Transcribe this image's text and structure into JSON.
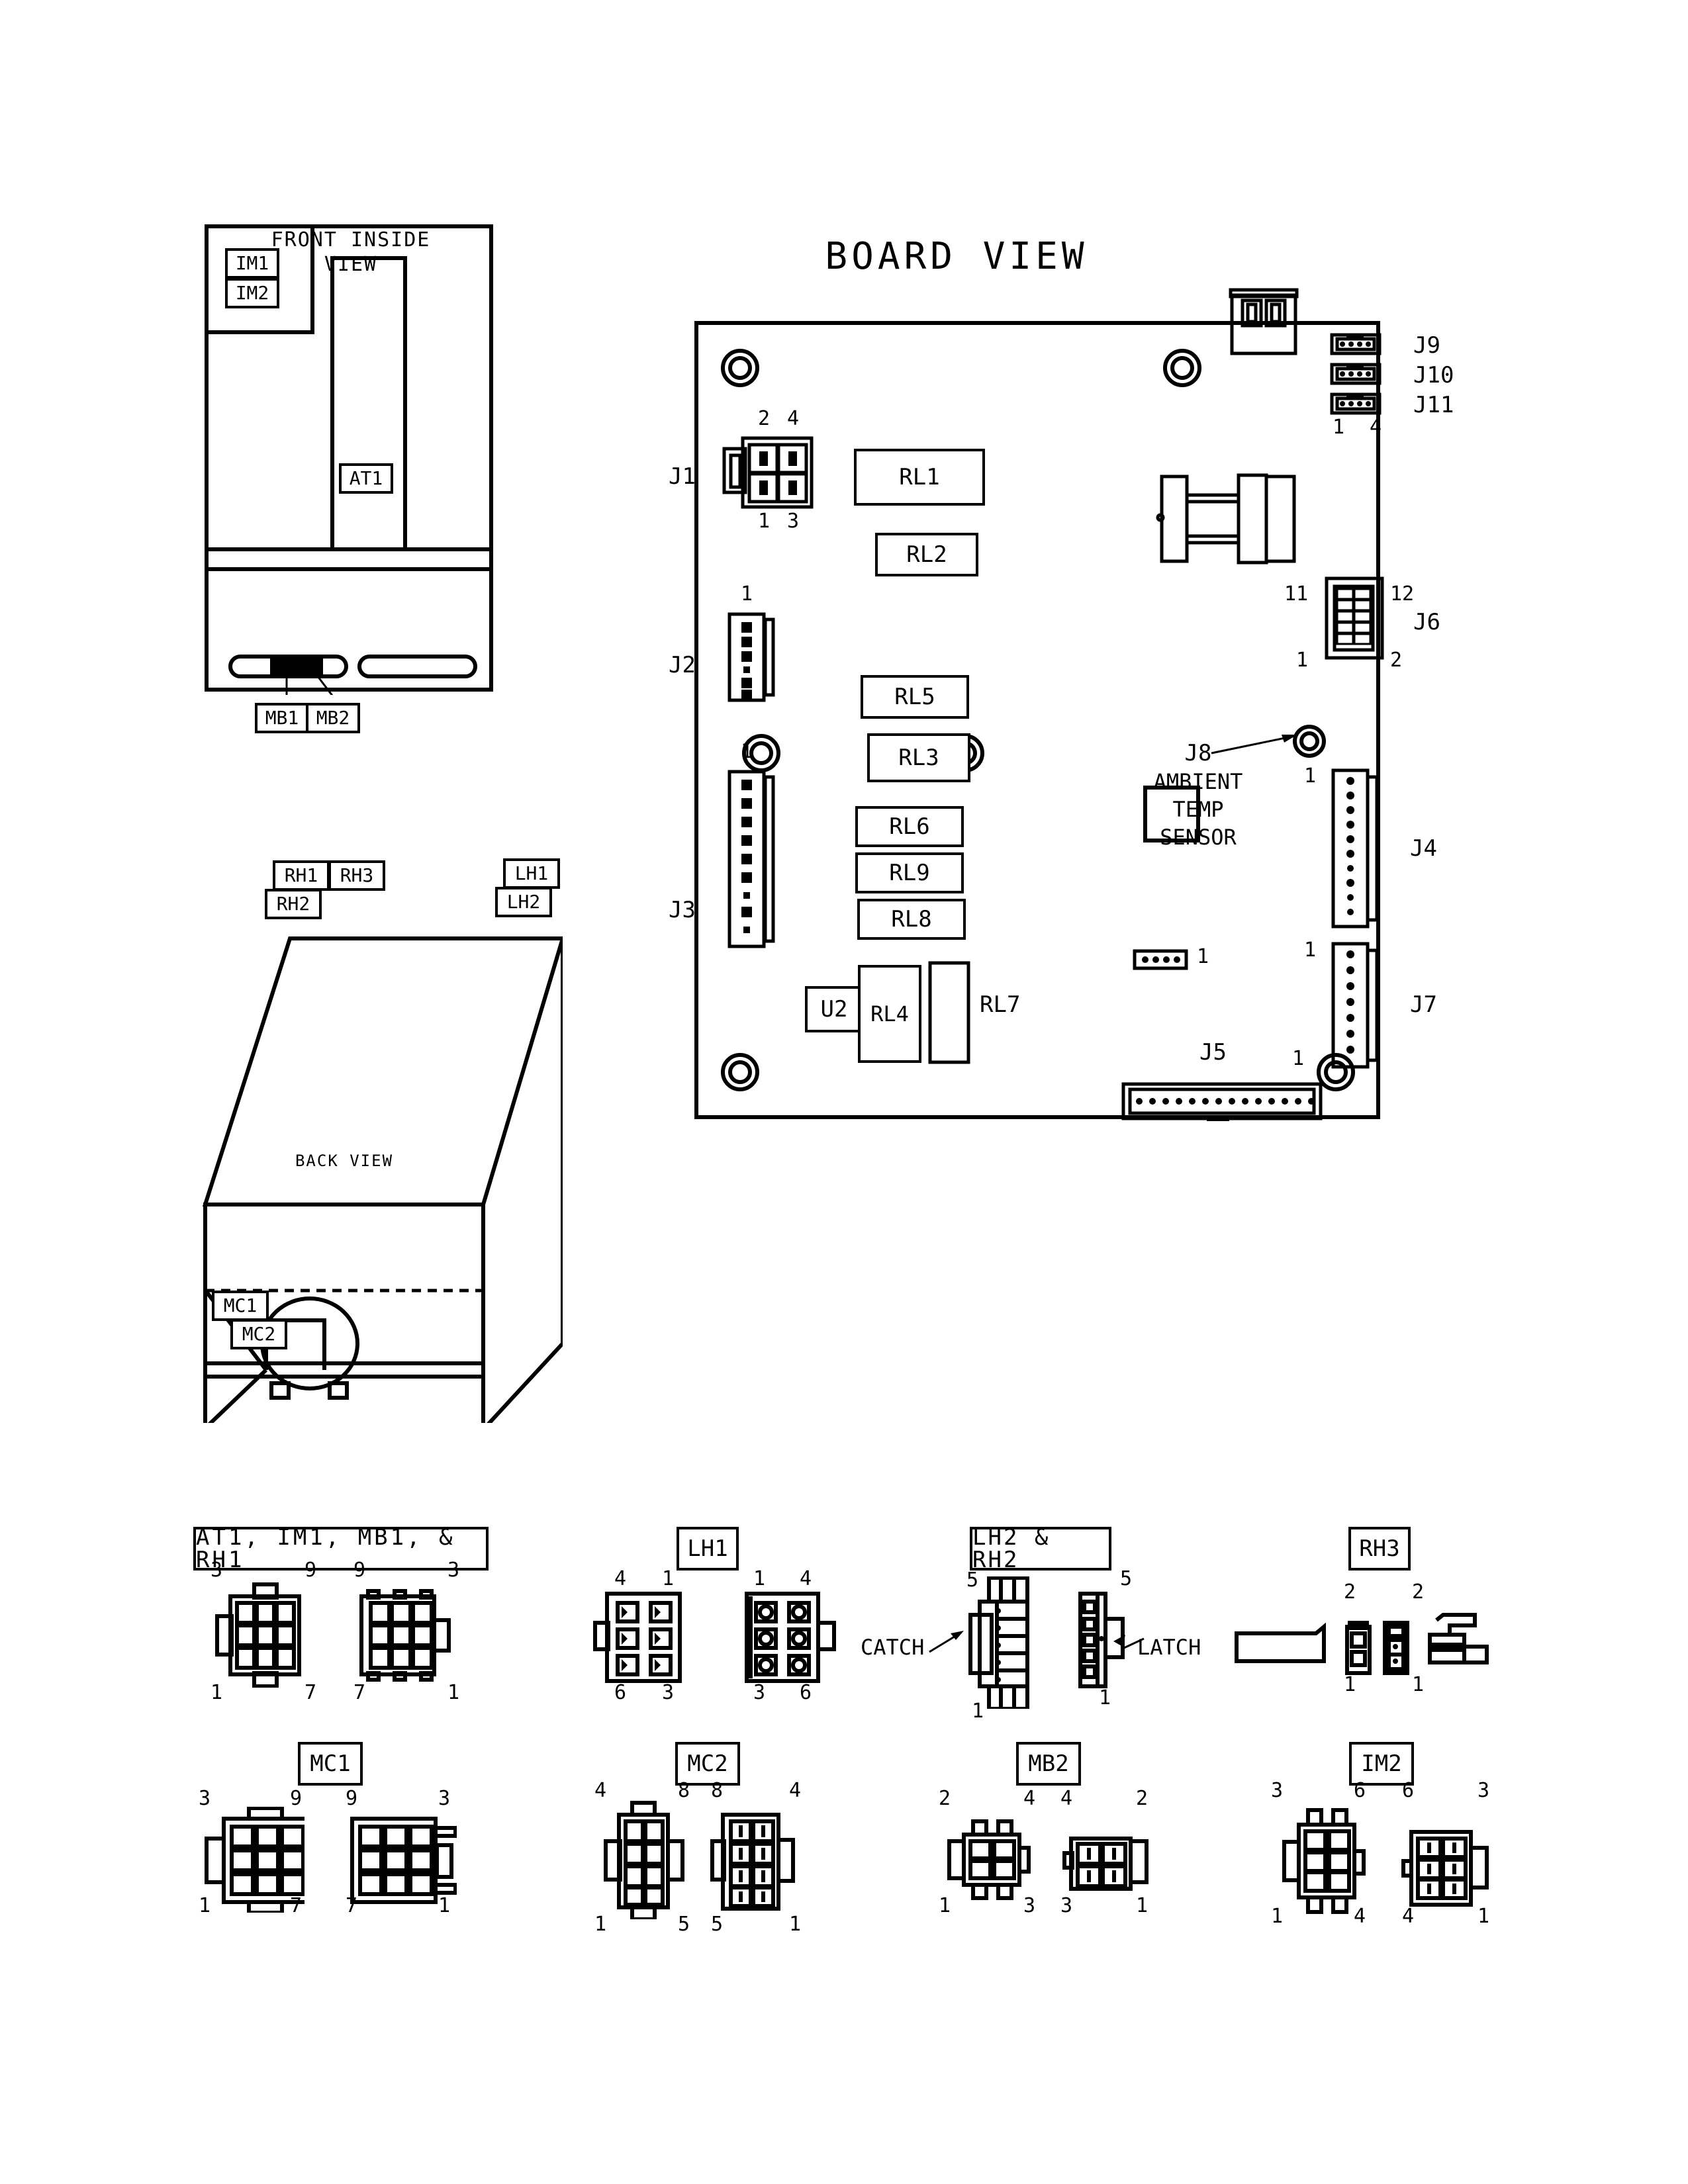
{
  "diagram": {
    "title": "BOARD VIEW",
    "views": {
      "front_inside": {
        "label_line1": "FRONT INSIDE",
        "label_line2": "VIEW",
        "callouts": [
          "IM1",
          "IM2",
          "AT1",
          "MB1",
          "MB2"
        ]
      },
      "back": {
        "label": "BACK VIEW",
        "callouts": [
          "RH1",
          "RH3",
          "RH2",
          "LH1",
          "LH2",
          "MC1",
          "MC2"
        ]
      }
    },
    "board": {
      "relays": [
        "RL1",
        "RL2",
        "RL5",
        "RL3",
        "RL6",
        "RL9",
        "RL8",
        "RL4",
        "RL7"
      ],
      "ic": "U2",
      "sensor_note": {
        "id": "J8",
        "line1": "AMBIENT",
        "line2": "TEMP",
        "line3": "SENSOR"
      },
      "connectors": [
        {
          "id": "J1",
          "pins_top": [
            "2",
            "4"
          ],
          "pins_bottom": [
            "1",
            "3"
          ]
        },
        {
          "id": "J2",
          "pin_first": "1"
        },
        {
          "id": "J3",
          "pin_first": "1"
        },
        {
          "id": "J9",
          "pin_first": "",
          "pin_last": ""
        },
        {
          "id": "J10",
          "pin_first": "",
          "pin_last": ""
        },
        {
          "id": "J11",
          "pin_first": "1",
          "pin_last": "4"
        },
        {
          "id": "J6",
          "pin_tl": "11",
          "pin_tr": "12",
          "pin_bl": "1",
          "pin_br": "2"
        },
        {
          "id": "J4",
          "pin_first": "1"
        },
        {
          "id": "J7",
          "pin_first": "1"
        },
        {
          "id": "J5",
          "pin_first": "1"
        },
        {
          "id": "J8",
          "pin_first": "1"
        }
      ]
    },
    "connector_details": [
      {
        "name": "AT1, IM1, MB1, & RH1",
        "left": {
          "tl": "3",
          "tr": "9",
          "bl": "1",
          "br": "7"
        },
        "right": {
          "tl": "9",
          "tr": "3",
          "bl": "7",
          "br": "1"
        }
      },
      {
        "name": "LH1",
        "left": {
          "tl": "4",
          "tr": "1",
          "bl": "6",
          "br": "3"
        },
        "right": {
          "tl": "1",
          "tr": "4",
          "bl": "3",
          "br": "6"
        }
      },
      {
        "name": "LH2 & RH2",
        "left": {
          "top": "5",
          "bottom": "1",
          "note": "CATCH"
        },
        "right": {
          "top": "5",
          "bottom": "1",
          "note": "LATCH"
        }
      },
      {
        "name": "RH3",
        "left": {
          "top": "2",
          "bottom": "1"
        },
        "right": {
          "top": "2",
          "bottom": "1"
        }
      },
      {
        "name": "MC1",
        "left": {
          "tl": "3",
          "tr": "9",
          "bl": "1",
          "br": "7"
        },
        "right": {
          "tl": "9",
          "tr": "3",
          "bl": "7",
          "br": "1"
        }
      },
      {
        "name": "MC2",
        "left": {
          "tl": "4",
          "tr": "8",
          "bl": "1",
          "br": "5"
        },
        "right": {
          "tl": "8",
          "tr": "4",
          "bl": "5",
          "br": "1"
        }
      },
      {
        "name": "MB2",
        "left": {
          "tl": "2",
          "tr": "4",
          "bl": "1",
          "br": "3"
        },
        "right": {
          "tl": "4",
          "tr": "2",
          "bl": "3",
          "br": "1"
        }
      },
      {
        "name": "IM2",
        "left": {
          "tl": "3",
          "tr": "6",
          "bl": "1",
          "br": "4"
        },
        "right": {
          "tl": "6",
          "tr": "3",
          "bl": "4",
          "br": "1"
        }
      }
    ],
    "colors": {
      "ink": "#000000",
      "paper": "#ffffff"
    }
  }
}
